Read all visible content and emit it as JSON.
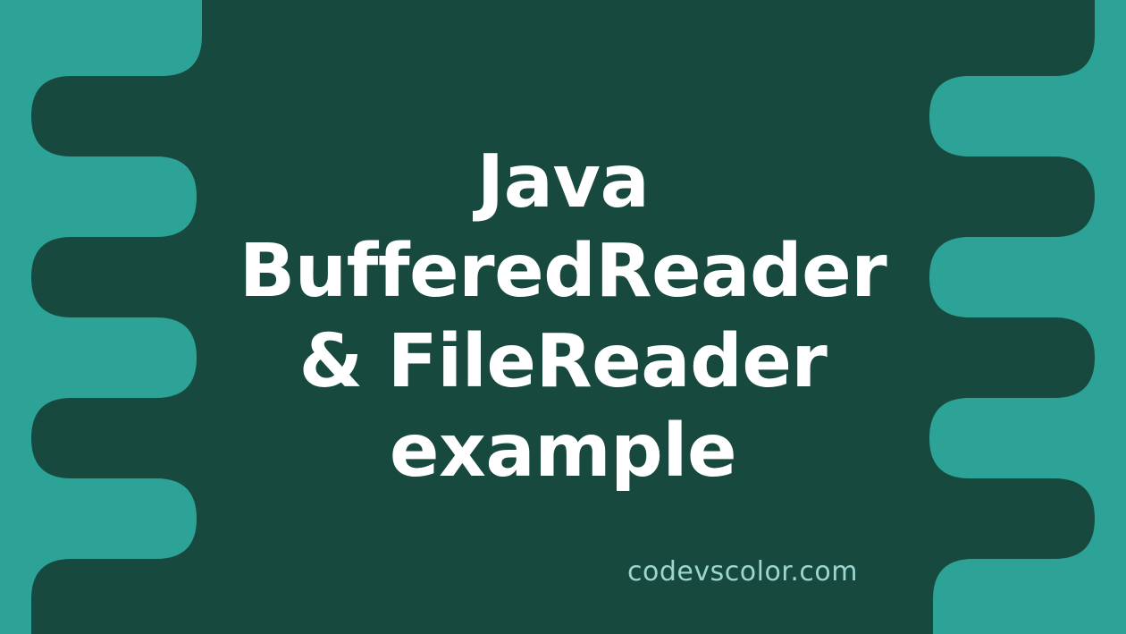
{
  "banner": {
    "title_line1": "Java",
    "title_line2": "BufferedReader",
    "title_line3": "& FileReader",
    "title_line4": "example",
    "attribution": "codevscolor.com"
  },
  "colors": {
    "background": "#2ca396",
    "blob": "#18493f",
    "text": "#ffffff",
    "attribution": "#9bd6cf"
  }
}
